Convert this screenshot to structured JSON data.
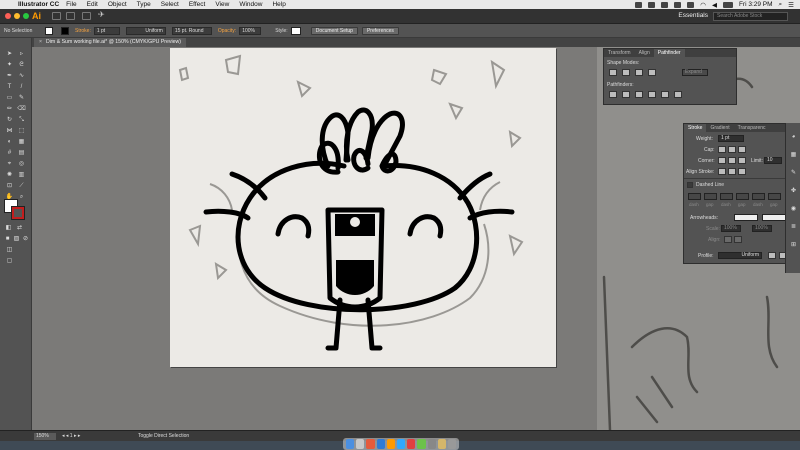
{
  "menubar": {
    "app_name": "Illustrator CC",
    "menus": [
      "File",
      "Edit",
      "Object",
      "Type",
      "Select",
      "Effect",
      "View",
      "Window",
      "Help"
    ],
    "clock": "Fri 3:29 PM"
  },
  "appbar": {
    "logo": "Ai",
    "workspace": "Essentials",
    "search_placeholder": "Search Adobe Stock"
  },
  "control_bar": {
    "selection": "No Selection",
    "stroke_label": "Stroke:",
    "stroke_weight": "1 pt",
    "profile": "Uniform",
    "brush": "15 pt. Round",
    "opacity_label": "Opacity:",
    "opacity": "100%",
    "style_label": "Style:",
    "document_setup": "Document Setup",
    "preferences": "Preferences"
  },
  "document": {
    "tab_title": "Dim & Sum working file.ai* @ 150% (CMYK/GPU Preview)"
  },
  "pathfinder_panel": {
    "tabs": [
      "Transform",
      "Align",
      "Pathfinder"
    ],
    "shape_modes": "Shape Modes:",
    "pathfinders": "Pathfinders:",
    "expand": "Expand"
  },
  "stroke_panel": {
    "tabs": [
      "Stroke",
      "Gradient",
      "Transparenc"
    ],
    "weight_label": "Weight:",
    "weight": "1 pt",
    "cap_label": "Cap:",
    "corner_label": "Corner:",
    "limit_label": "Limit:",
    "limit": "10",
    "align_label": "Align Stroke:",
    "dashed_label": "Dashed Line",
    "dash_labels": [
      "dash",
      "gap",
      "dash",
      "gap",
      "dash",
      "gap"
    ],
    "arrowheads_label": "Arrowheads:",
    "scale_label": "Scale:",
    "scale_1": "100%",
    "scale_2": "100%",
    "align_arrows_label": "Align:",
    "profile_label": "Profile:",
    "profile": "Uniform"
  },
  "status_bar": {
    "zoom": "150%",
    "message": "Toggle Direct Selection"
  },
  "colors": {
    "accent_orange": "#ff9a00",
    "ui_dark": "#535353",
    "artboard": "#eceae6"
  }
}
